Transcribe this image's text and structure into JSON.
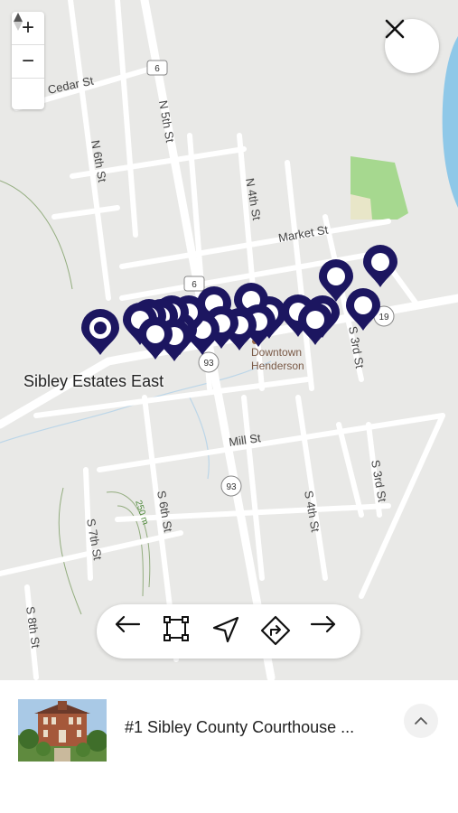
{
  "map": {
    "streets": {
      "cedar": "Cedar St",
      "n6": "N 6th St",
      "n5": "N 5th St",
      "n4": "N 4th St",
      "market": "Market St",
      "s3_top": "S 3rd St",
      "mill": "Mill St",
      "s3_bottom": "S 3rd St",
      "s4": "S 4th St",
      "s6": "S 6th St",
      "s7": "S 7th St",
      "s8": "S 8th St"
    },
    "route_shields": {
      "r6_top": "6",
      "r6_mid": "6",
      "r19": "19",
      "r93_a": "93",
      "r93_b": "93"
    },
    "contour_label": "250 m",
    "place_label": "Sibley Estates East",
    "poi_label_line1": "Downtown",
    "poi_label_line2": "Henderson",
    "marker_color": "#1c1660"
  },
  "zoom": {
    "in": "+",
    "out": "−",
    "north": "north-arrow-icon"
  },
  "toolbar": {
    "prev": "arrow-left-icon",
    "fit": "fit-bounds-icon",
    "locate": "navigation-icon",
    "directions": "directions-icon",
    "next": "arrow-right-icon"
  },
  "card": {
    "title": "#1 Sibley County Courthouse ...",
    "expand": "chevron-up-icon"
  }
}
